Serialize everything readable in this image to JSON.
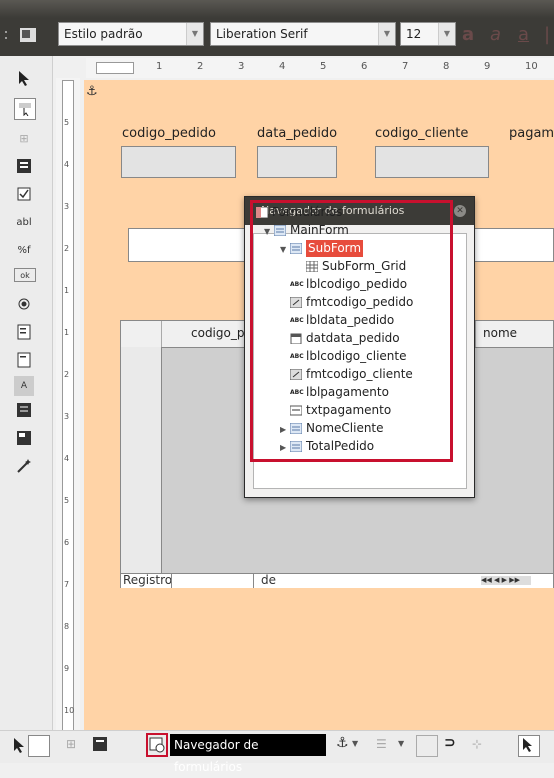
{
  "toolbar": {
    "paragraph_style": "Estilo padrão",
    "font_name": "Liberation Serif",
    "font_size": "12"
  },
  "ruler": {
    "ticks": [
      "1",
      "2",
      "3",
      "4",
      "5",
      "6",
      "7",
      "8",
      "9",
      "10"
    ],
    "vticks": [
      "5",
      "4",
      "3",
      "2",
      "1",
      "1",
      "2",
      "3",
      "4",
      "5",
      "6",
      "7",
      "8",
      "9",
      "10"
    ]
  },
  "form_labels": {
    "codigo_pedido": "codigo_pedido",
    "data_pedido": "data_pedido",
    "codigo_cliente": "codigo_cliente",
    "pagamento": "pagam"
  },
  "grid": {
    "col1": "codigo_p",
    "col2": "nome",
    "record_label": "Registro",
    "of_label": "de"
  },
  "navigator": {
    "title": "Navegador de formulários",
    "items": [
      {
        "label": "Formulários"
      },
      {
        "label": "MainForm"
      },
      {
        "label": "SubForm"
      },
      {
        "label": "SubForm_Grid"
      },
      {
        "label": "lblcodigo_pedido"
      },
      {
        "label": "fmtcodigo_pedido"
      },
      {
        "label": "lbldata_pedido"
      },
      {
        "label": "datdata_pedido"
      },
      {
        "label": "lblcodigo_cliente"
      },
      {
        "label": "fmtcodigo_cliente"
      },
      {
        "label": "lblpagamento"
      },
      {
        "label": "txtpagamento"
      },
      {
        "label": "NomeCliente"
      },
      {
        "label": "TotalPedido"
      }
    ]
  },
  "tooltip": "Navegador de formulários",
  "colors": {
    "highlight": "#c8102e",
    "page": "#ffd3a6",
    "selection": "#e74c3c"
  }
}
